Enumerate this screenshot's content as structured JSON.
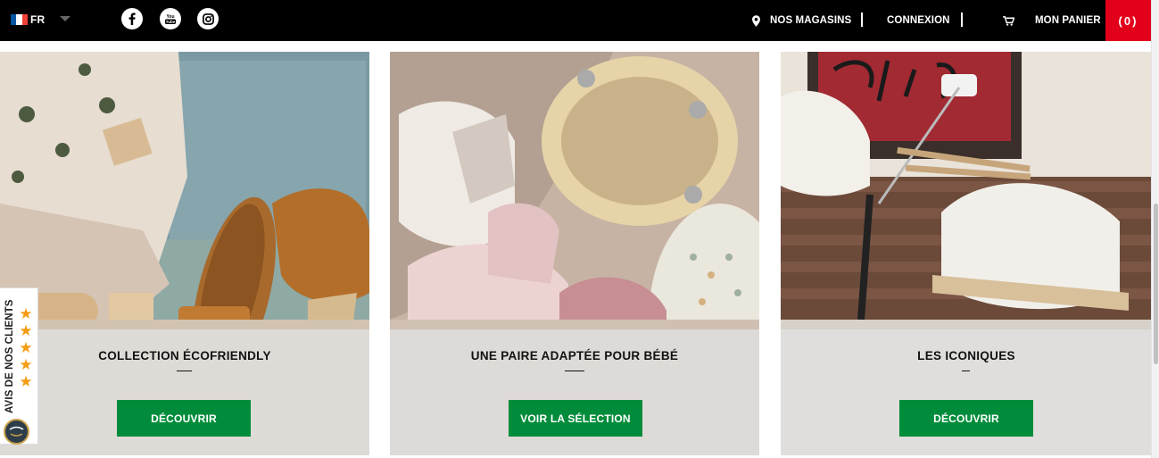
{
  "header": {
    "language": {
      "code": "FR",
      "flag_colors": [
        "#0055a4",
        "#ffffff",
        "#ef4135"
      ]
    },
    "social": [
      {
        "name": "facebook",
        "icon": "facebook-icon"
      },
      {
        "name": "youtube",
        "icon": "youtube-icon"
      },
      {
        "name": "instagram",
        "icon": "instagram-icon"
      }
    ],
    "nav": {
      "stores": "NOS MAGASINS",
      "login": "CONNEXION",
      "cart": "MON PANIER",
      "cart_count": "(0)"
    }
  },
  "cards": [
    {
      "title": "COLLECTION ÉCOFRIENDLY",
      "button": "DÉCOUVRIR"
    },
    {
      "title": "UNE PAIRE ADAPTÉE POUR BÉBÉ",
      "button": "VOIR LA SÉLECTION"
    },
    {
      "title": "LES ICONIQUES",
      "button": "DÉCOUVRIR"
    }
  ],
  "reviews_widget": {
    "label": "AVIS DE NOS CLIENTS",
    "stars": 5,
    "seal": "Avis Vérifiés"
  },
  "colors": {
    "topbar": "#000000",
    "cart_badge": "#e2001a",
    "button": "#008c3a",
    "star": "#f39c12"
  }
}
